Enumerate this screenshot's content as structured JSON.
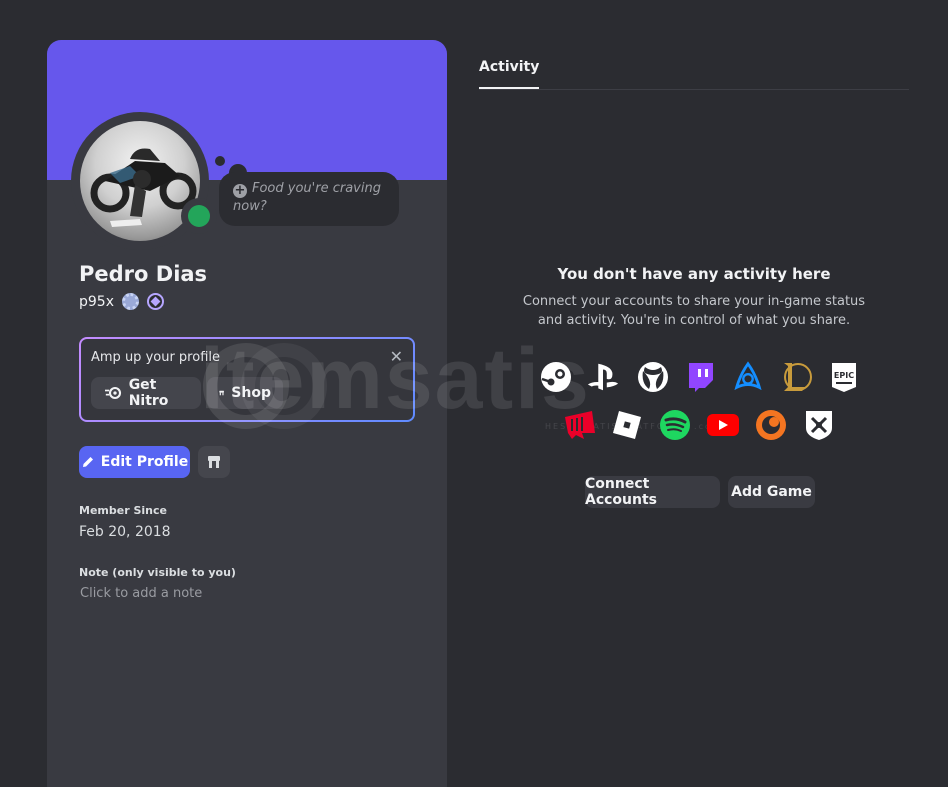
{
  "profile": {
    "display_name": "Pedro Dias",
    "username": "p95x",
    "status_bubble": "Food you're craving now?",
    "status_color": "#23a55a",
    "banner_color": "#6657ec"
  },
  "nitro_promo": {
    "title": "Amp up your profile",
    "get_nitro_label": "Get Nitro",
    "shop_label": "Shop"
  },
  "actions": {
    "edit_profile_label": "Edit Profile",
    "accent": "#5865f2"
  },
  "member_since": {
    "label": "Member Since",
    "value": "Feb 20, 2018"
  },
  "note": {
    "label": "Note (only visible to you)",
    "placeholder": "Click to add a note"
  },
  "activity": {
    "tab_label": "Activity",
    "empty_title": "You don't have any activity here",
    "empty_desc_line1": "Connect your accounts to share your in-game status",
    "empty_desc_line2": "and activity. You're in control of what you share.",
    "connect_label": "Connect Accounts",
    "add_game_label": "Add Game",
    "services": [
      "steam",
      "playstation",
      "xbox",
      "twitch",
      "battlenet",
      "league-of-legends",
      "epic-games",
      "riot-games",
      "roblox",
      "spotify",
      "youtube",
      "crunchyroll",
      "bungie"
    ],
    "epic_logo_text": "EPIC"
  },
  "watermark": {
    "text": "itemsatis",
    "sub": "HESAP SATIŞ PLATFORMU .com"
  }
}
